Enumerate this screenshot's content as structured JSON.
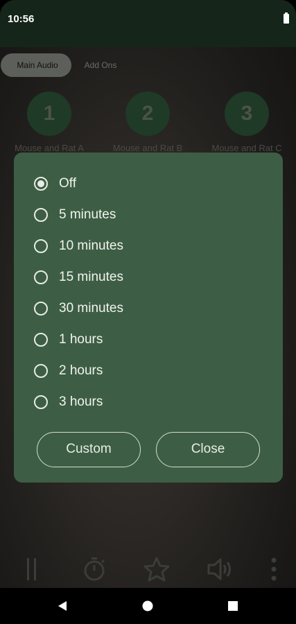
{
  "status_bar": {
    "time": "10:56"
  },
  "tabs": [
    {
      "label": "Main Audio",
      "active": true
    },
    {
      "label": "Add Ons",
      "active": false
    }
  ],
  "sounds": [
    {
      "number": "1",
      "label": "Mouse and Rat A"
    },
    {
      "number": "2",
      "label": "Mouse and Rat B"
    },
    {
      "number": "3",
      "label": "Mouse and Rat C"
    }
  ],
  "timer_dialog": {
    "options": [
      {
        "label": "Off",
        "checked": true
      },
      {
        "label": "5 minutes",
        "checked": false
      },
      {
        "label": "10 minutes",
        "checked": false
      },
      {
        "label": "15 minutes",
        "checked": false
      },
      {
        "label": "30 minutes",
        "checked": false
      },
      {
        "label": "1 hours",
        "checked": false
      },
      {
        "label": "2 hours",
        "checked": false
      },
      {
        "label": "3 hours",
        "checked": false
      }
    ],
    "custom_label": "Custom",
    "close_label": "Close"
  },
  "bottom_bar": {
    "icons": [
      "pause-icon",
      "timer-icon",
      "star-icon",
      "volume-icon",
      "more-vertical-icon"
    ]
  },
  "colors": {
    "dialog_bg": "#3d5e44",
    "status_bar_bg": "#15251a",
    "sound_circle_bg": "#1f3a27"
  }
}
